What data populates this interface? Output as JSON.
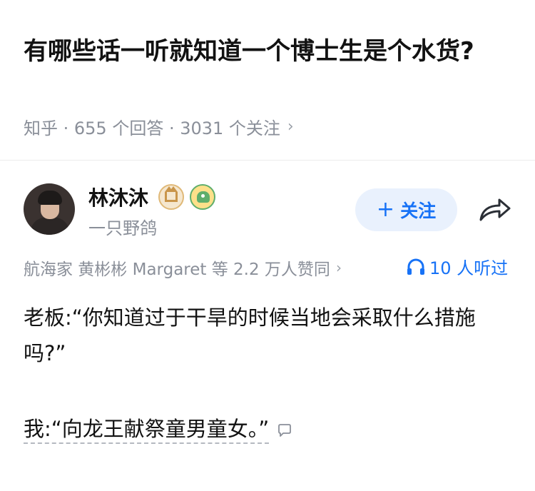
{
  "question": {
    "title": "有哪些话一听就知道一个博士生是个水货?",
    "meta": "知乎 · 655 个回答 · 3031 个关注",
    "meta_chevron": "›"
  },
  "author": {
    "name": "林沐沐",
    "bio": "一只野鸽",
    "follow_label": "关注",
    "follow_plus": "+"
  },
  "votes": {
    "text": "航海家 黄彬彬 Margaret 等 2.2 万人赞同",
    "chevron": "›"
  },
  "listened": {
    "text": "10 人听过"
  },
  "answer": {
    "line1": "老板:“你知道过于干旱的时候当地会采取什么措施吗?”",
    "line2": "我:“向龙王献祭童男童女。”"
  },
  "colors": {
    "accent": "#1772f6",
    "follow_bg": "#e9f1fd",
    "meta_gray": "#8a8f99"
  },
  "icons": [
    "share-icon",
    "headphone-icon",
    "comment-icon",
    "gold-badge-icon",
    "dino-badge-icon"
  ]
}
